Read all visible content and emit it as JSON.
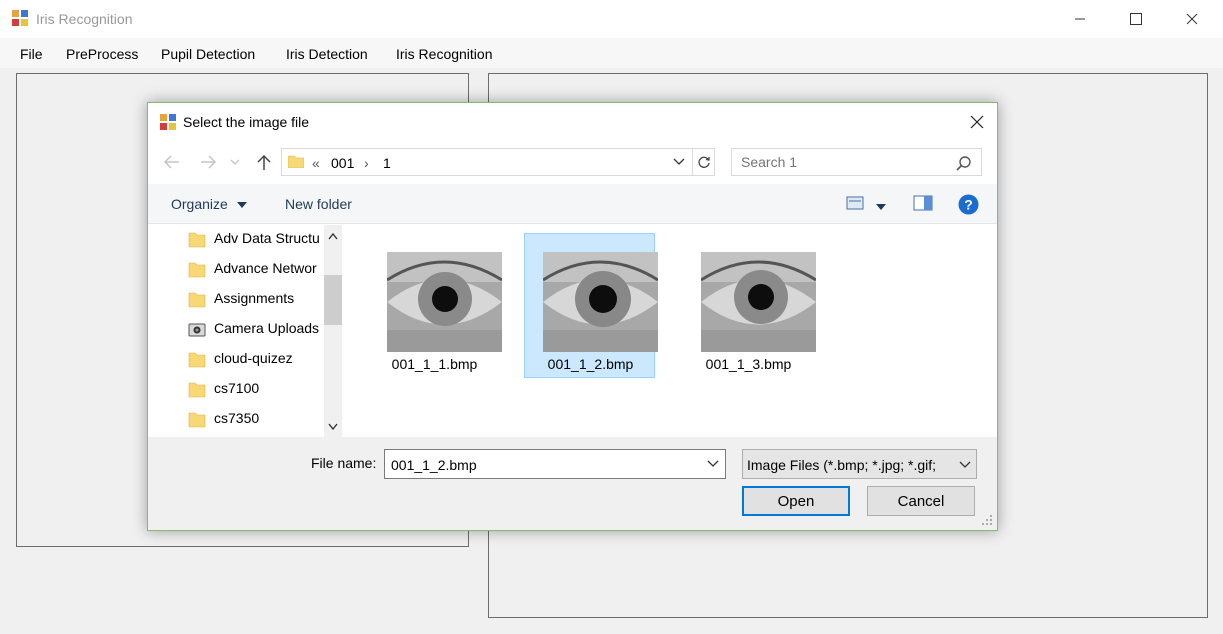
{
  "window": {
    "title": "Iris Recognition"
  },
  "menu": [
    "File",
    "PreProcess",
    "Pupil Detection",
    "Iris Detection",
    "Iris Recognition"
  ],
  "dialog": {
    "title": "Select the image file",
    "breadcrumb": {
      "overflow": "«",
      "parts": [
        "001",
        "1"
      ],
      "separator": "›"
    },
    "search_placeholder": "Search 1",
    "toolbar": {
      "organize": "Organize",
      "new_folder": "New folder"
    },
    "nav_items": [
      {
        "label": "Adv Data Structu",
        "icon": "folder-icon"
      },
      {
        "label": "Advance Networ",
        "icon": "folder-icon"
      },
      {
        "label": "Assignments",
        "icon": "folder-icon"
      },
      {
        "label": "Camera Uploads",
        "icon": "camera-folder-icon"
      },
      {
        "label": "cloud-quizez",
        "icon": "folder-icon"
      },
      {
        "label": "cs7100",
        "icon": "folder-icon"
      },
      {
        "label": "cs7350",
        "icon": "folder-icon"
      }
    ],
    "files": [
      {
        "name": "001_1_1.bmp",
        "selected": false
      },
      {
        "name": "001_1_2.bmp",
        "selected": true
      },
      {
        "name": "001_1_3.bmp",
        "selected": false
      }
    ],
    "file_name_label": "File name:",
    "file_name_value": "001_1_2.bmp",
    "filter_value": "Image Files (*.bmp; *.jpg; *.gif;",
    "open_label": "Open",
    "cancel_label": "Cancel"
  },
  "colors": {
    "selection": "#cce8ff",
    "selection_border": "#99d1ff",
    "link": "#1e395b",
    "accent": "#0078d7"
  }
}
